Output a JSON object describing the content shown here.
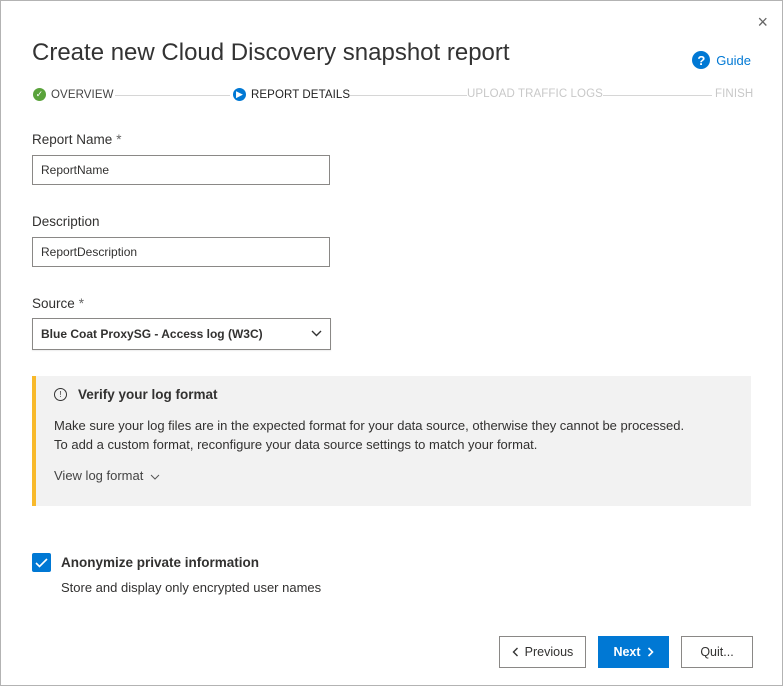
{
  "dialog": {
    "title": "Create new Cloud Discovery snapshot report",
    "close_glyph": "×",
    "guide_label": "Guide"
  },
  "steps": [
    {
      "label": "OVERVIEW",
      "state": "done"
    },
    {
      "label": "REPORT DETAILS",
      "state": "active"
    },
    {
      "label": "UPLOAD TRAFFIC LOGS",
      "state": "pending"
    },
    {
      "label": "FINISH",
      "state": "pending"
    }
  ],
  "form": {
    "report_name": {
      "label": "Report Name",
      "required": "*",
      "value": "ReportName"
    },
    "description": {
      "label": "Description",
      "value": "ReportDescription"
    },
    "source": {
      "label": "Source",
      "required": "*",
      "selected": "Blue Coat ProxySG - Access log (W3C)"
    }
  },
  "notice": {
    "title": "Verify your log format",
    "text": "Make sure your log files are in the expected format for your data source, otherwise they cannot be processed. To add a custom format, reconfigure your data source settings to match your format.",
    "link": "View log format"
  },
  "anonymize": {
    "checked": true,
    "label": "Anonymize private information",
    "description": "Store and display only encrypted user names"
  },
  "buttons": {
    "previous": "Previous",
    "next": "Next",
    "quit": "Quit..."
  },
  "colors": {
    "accent": "#0078d4",
    "done": "#5aa33b",
    "warning_bar": "#f8b92b"
  }
}
